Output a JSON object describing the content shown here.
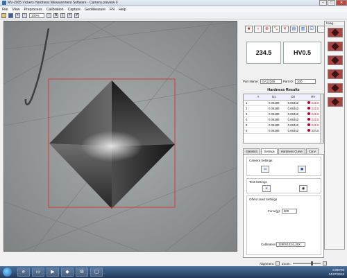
{
  "window": {
    "title": "MV-2005 Vickers Hardness Measurement Software - Camera preview 0"
  },
  "menu": [
    "File",
    "View",
    "Preprocess",
    "Calibration",
    "Capture",
    "GeoMeasure",
    "FN",
    "Help"
  ],
  "toolbar": {
    "zoom_value": "100%"
  },
  "readout": {
    "value": "234.5",
    "scale": "HV0.5"
  },
  "part": {
    "name_label": "Part Name:",
    "name_value": "SA12345",
    "id_label": "Part ID:",
    "id_value": "100"
  },
  "hardness": {
    "title": "Hardness Results",
    "columns": [
      "",
      "Y",
      "D1",
      "D2",
      "HV"
    ],
    "rows": [
      {
        "n": "1",
        "y": "",
        "d1": "0.06285",
        "d2": "0.06342",
        "hv": "232.5",
        "hv_color": "#c01818"
      },
      {
        "n": "2",
        "y": "",
        "d1": "0.06285",
        "d2": "0.06342",
        "hv": "232.5",
        "hv_color": "#c01818"
      },
      {
        "n": "3",
        "y": "",
        "d1": "0.06285",
        "d2": "0.06342",
        "hv": "232.5",
        "hv_color": "#c01818"
      },
      {
        "n": "4",
        "y": "",
        "d1": "0.06285",
        "d2": "0.06342",
        "hv": "232.5",
        "hv_color": "#c01818"
      },
      {
        "n": "5",
        "y": "",
        "d1": "0.06285",
        "d2": "0.06342",
        "hv": "232.5",
        "hv_color": "#c01818"
      },
      {
        "n": "6",
        "y": "",
        "d1": "0.06285",
        "d2": "0.06342",
        "hv": "234.5",
        "hv_color": "#111111"
      }
    ]
  },
  "tabs": [
    "Statistics",
    "Settings",
    "Hardness Curve",
    "Conv"
  ],
  "settings": {
    "camera_group": "Camera Settings",
    "test_group": "Test Settings",
    "often_group": "Often Used Settings",
    "force_label": "Force(g):",
    "force_value": "500",
    "calibration_label": "Calibration",
    "calibration_value": "1280X1024_40X"
  },
  "status": {
    "alignment": "Alignment",
    "zoom": "Zoom:"
  },
  "image_panel": {
    "title": "Imag..."
  },
  "taskbar": {
    "time": "6:09 PM",
    "date": "14/07/2016"
  },
  "colors": {
    "accent": "#2a55b5",
    "measure_box": "#d03a3a"
  }
}
